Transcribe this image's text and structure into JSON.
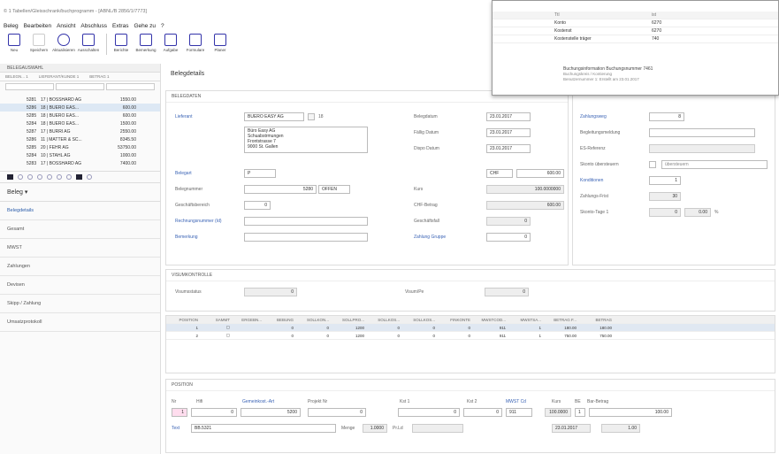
{
  "window": {
    "title": "© 1 Tabellen/Gleisschrank/buchprogramm - [ABNL/B 2856/1/7773]"
  },
  "menu": [
    "Beleg",
    "Bearbeiten",
    "Ansicht",
    "Abschluss",
    "Extras",
    "Gehe zu",
    "?"
  ],
  "toolbar": [
    {
      "label": "Neu",
      "icon": "new-icon"
    },
    {
      "label": "Speichern",
      "icon": "save-icon"
    },
    {
      "label": "Aktualisieren",
      "icon": "refresh-icon"
    },
    {
      "label": "Ausschalten",
      "icon": "off-icon"
    },
    {
      "label": "Berichte",
      "icon": "report-icon"
    },
    {
      "label": "Bemerkung",
      "icon": "note-icon"
    },
    {
      "label": "Aufgabe",
      "icon": "task-icon"
    },
    {
      "label": "Formulare",
      "icon": "form-icon"
    },
    {
      "label": "Planer",
      "icon": "plan-icon"
    }
  ],
  "left": {
    "header": "BELEGAUSWAHL",
    "columns": [
      "BELEGN... 1",
      "LIEFERANT/KUNDE 1",
      "BETRAG 1"
    ],
    "rows": [
      {
        "nr": "5281",
        "name": "17 | BOSSHARD AG",
        "amount": "1550.00"
      },
      {
        "nr": "5286",
        "name": "18 | BUERO EAS...",
        "amount": "600.00",
        "selected": true
      },
      {
        "nr": "5285",
        "name": "18 | BUERO EAS...",
        "amount": "600.00"
      },
      {
        "nr": "5284",
        "name": "18 | BUERO EAS...",
        "amount": "1500.00"
      },
      {
        "nr": "5287",
        "name": "17 | BURRI AG",
        "amount": "2550.00"
      },
      {
        "nr": "5286",
        "name": "11 | MATTER & SC...",
        "amount": "8345.50"
      },
      {
        "nr": "5285",
        "name": "20 | FEHR AG",
        "amount": "53750.00"
      },
      {
        "nr": "5284",
        "name": "10 | STAHL AG",
        "amount": "1000.00"
      },
      {
        "nr": "5283",
        "name": "17 | BOSSHARD AG",
        "amount": "7400.00"
      }
    ],
    "section_label": "Beleg",
    "nav": [
      "Belegdetails",
      "Gesamt",
      "MWST",
      "Zahlungen",
      "Devisen",
      "Skipp / Zahlung",
      "Umsatzprotokoll"
    ]
  },
  "main": {
    "title": "Belegdetails",
    "beleg": {
      "header": "BELEGDATEN",
      "lieferant_label": "Lieferant",
      "lieferant": "BUERO EASY AG",
      "lieferant_nr": "18",
      "address": [
        "Büro Easy AG",
        "Schuabstrmungen",
        "Frontstrasse 7",
        "9000 St. Gallen"
      ],
      "belegart_label": "Belegart",
      "belegart": "P",
      "belegnummer_label": "Belegnummer",
      "belegnummer": "5280",
      "status": "OFFEN",
      "geschaeftsbereich_label": "Geschäftsbereich",
      "geschaeftsbereich": "0",
      "rechnungsnummer_label": "Rechnungsnummer (Id)",
      "bemerkung_label": "Bemerkung",
      "belegdatum_label": "Belegdatum",
      "belegdatum": "23.01.2017",
      "faellig_label": "Fällig Datum",
      "faellig": "23.01.2017",
      "erfasst_label": "Dispo Datum",
      "erfasst": "23.01.2017",
      "waehrung": "CHF",
      "betrag": "600.00",
      "kurs_label": "Kurs",
      "kurs": "100.0000000",
      "chf_label": "CHF-Betrag",
      "chf": "600.00",
      "geschaeftsfall_label": "Geschäftsfall",
      "geschaeftsfall": "0",
      "zahlung_label": "Zahlung Gruppe",
      "zahlung": "0"
    },
    "zahlung": {
      "zahlungsweg_label": "Zahlungsweg",
      "zahlungsweg": "8",
      "begleit_label": "Begleitungsmeldung",
      "es_label": "ES-Referenz",
      "skonto_label": "Skonto übersteuern",
      "skonto_select": "übersteuern",
      "konditionen_label": "Konditionen",
      "konditionen": "1",
      "frist_label": "Zahlungs-Frist",
      "frist": "30",
      "skonto_tage_label": "Skonto-Tage 1",
      "skonto_tage": "0",
      "skonto_pct": "0.00",
      "pct": "%"
    },
    "kontrolle": {
      "header": "VISUMKONTROLLE",
      "visum_label": "Visumsstatus",
      "visum": "0",
      "visum2_label": "Visum/Pe",
      "visum2": "0"
    },
    "table": {
      "columns": [
        "POSITION",
        "SAMMT",
        "ERGEBN...",
        "BEBUNG",
        "SOLLKON...",
        "SOLLPRO...",
        "SOLLKOS...",
        "SOLLKOS...",
        "FINKONTE",
        "MWSTCOD...",
        "MWSTSA...",
        "BETRAG F...",
        "BETRAG"
      ],
      "rows": [
        [
          "1",
          "",
          "0",
          "0",
          "1200",
          "0",
          "0",
          "0",
          "911",
          "1",
          "180.00",
          "180.00"
        ],
        [
          "2",
          "",
          "0",
          "0",
          "1200",
          "0",
          "0",
          "0",
          "911",
          "1",
          "750.00",
          "750.00"
        ]
      ]
    },
    "position": {
      "header": "POSITION",
      "labels": [
        "Nr",
        "Hifi",
        "Gemeinkost.-Art",
        "Projekt Nr",
        "Kst 1",
        "Kst 2",
        "MWST Cd",
        "Kurs",
        "BE",
        "Bar-Betrag"
      ],
      "nr": "1",
      "hifi": "0",
      "gemeinkost": "5200",
      "projekt": "0",
      "kst1": "0",
      "kst2": "0",
      "mwst": "911",
      "kurs": "100.0000",
      "be": "1",
      "betrag": "100.00",
      "text_label": "Text",
      "text": "BB.5321",
      "menge_label": "Menge",
      "menge": "1.0000",
      "preis_label": "Pr.Ld",
      "datum": "23.01.2017",
      "wert": "1.00"
    }
  },
  "popup": {
    "columns": [
      "Ttl",
      "ist"
    ],
    "rows": [
      [
        "Konto",
        "6270"
      ],
      [
        "Kostenst",
        "6270"
      ],
      [
        "Kostenstelle träger",
        "740"
      ]
    ],
    "info_title": "Buchungsinformation Buchungsnummer 7461",
    "info_lines": [
      "Buchungskreis / Kontierung",
      "Benutzernummer 1: Erstellt am 23.01.2017"
    ]
  }
}
